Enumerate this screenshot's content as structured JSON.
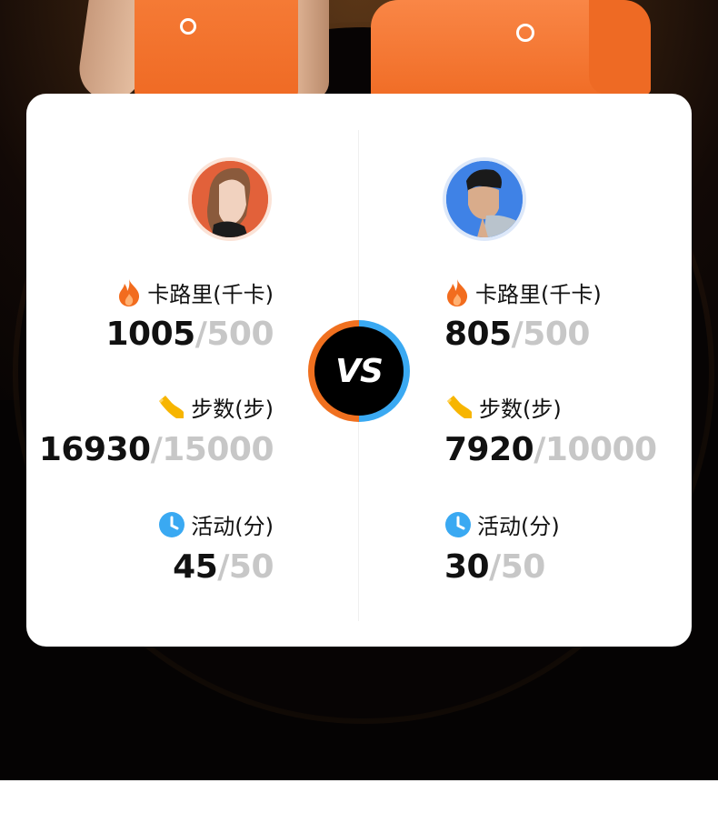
{
  "vs_label": "VS",
  "left": {
    "calories": {
      "label": "卡路里(千卡)",
      "value": "1005",
      "target": "/500"
    },
    "steps": {
      "label": "步数(步)",
      "value": "16930",
      "target": "/15000"
    },
    "activity": {
      "label": "活动(分)",
      "value": "45",
      "target": "/50"
    }
  },
  "right": {
    "calories": {
      "label": "卡路里(千卡)",
      "value": "805",
      "target": "/500"
    },
    "steps": {
      "label": "步数(步)",
      "value": "7920",
      "target": "/10000"
    },
    "activity": {
      "label": "活动(分)",
      "value": "30",
      "target": "/50"
    }
  },
  "colors": {
    "brand_orange": "#f0701f",
    "brand_blue": "#3aa9f2",
    "step_yellow": "#f7b500",
    "target_grey": "#c7c7c7"
  },
  "icons": {
    "calories": "flame-icon",
    "steps": "shoe-icon",
    "activity": "clock-icon"
  }
}
